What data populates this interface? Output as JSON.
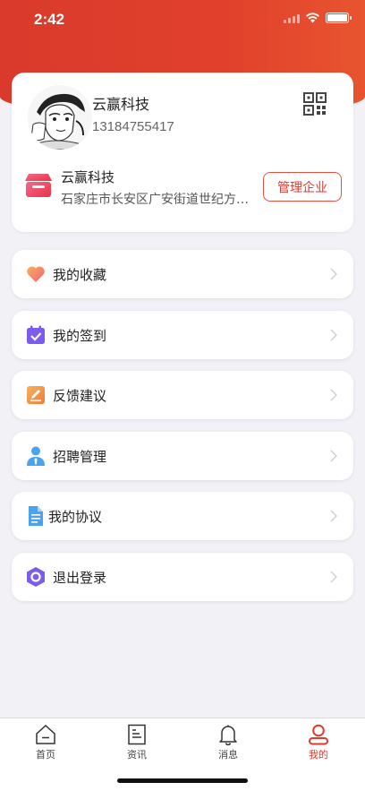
{
  "status_bar": {
    "time": "2:42"
  },
  "profile": {
    "name": "云赢科技",
    "phone": "13184755417",
    "qr_icon": "qr-code-icon",
    "avatar": "anime-avatar"
  },
  "company": {
    "name": "云赢科技",
    "address": "石家庄市长安区广安街道世纪方…",
    "manage_label": "管理企业",
    "icon": "store-icon"
  },
  "menu": {
    "favorites": {
      "label": "我的收藏",
      "icon": "heart-icon"
    },
    "signin": {
      "label": "我的签到",
      "icon": "calendar-check-icon"
    },
    "feedback": {
      "label": "反馈建议",
      "icon": "edit-icon"
    },
    "recruit": {
      "label": "招聘管理",
      "icon": "person-tie-icon"
    },
    "agreement": {
      "label": "我的协议",
      "icon": "document-icon"
    },
    "logout": {
      "label": "退出登录",
      "icon": "hexagon-icon"
    }
  },
  "tabs": {
    "home": {
      "label": "首页",
      "icon": "home-icon"
    },
    "news": {
      "label": "资讯",
      "icon": "news-icon"
    },
    "messages": {
      "label": "消息",
      "icon": "bell-icon"
    },
    "mine": {
      "label": "我的",
      "icon": "person-icon",
      "active": true
    }
  },
  "colors": {
    "brand": "#e03a2c",
    "background": "#f2f1f6"
  }
}
